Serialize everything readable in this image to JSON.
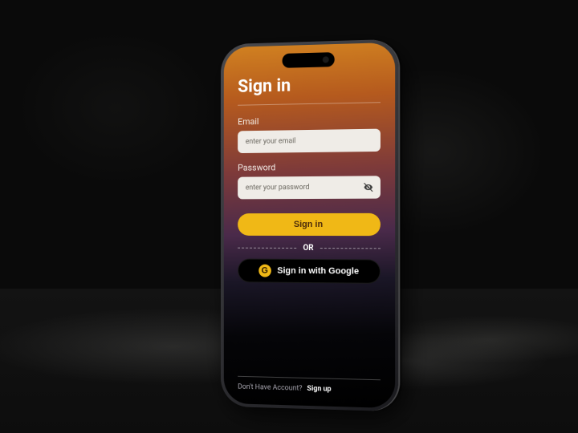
{
  "screen": {
    "title": "Sign in"
  },
  "fields": {
    "email": {
      "label": "Email",
      "placeholder": "enter your email"
    },
    "password": {
      "label": "Password",
      "placeholder": "enter your password"
    }
  },
  "buttons": {
    "signin": "Sign in",
    "google": "Sign in with Google"
  },
  "separator": {
    "label": "OR"
  },
  "footer": {
    "prompt": "Don't Have Account?",
    "link": "Sign up"
  },
  "icons": {
    "google_letter": "G"
  },
  "colors": {
    "accent": "#f0b816",
    "gradient_top": "#d08020",
    "gradient_bottom": "#000000"
  }
}
